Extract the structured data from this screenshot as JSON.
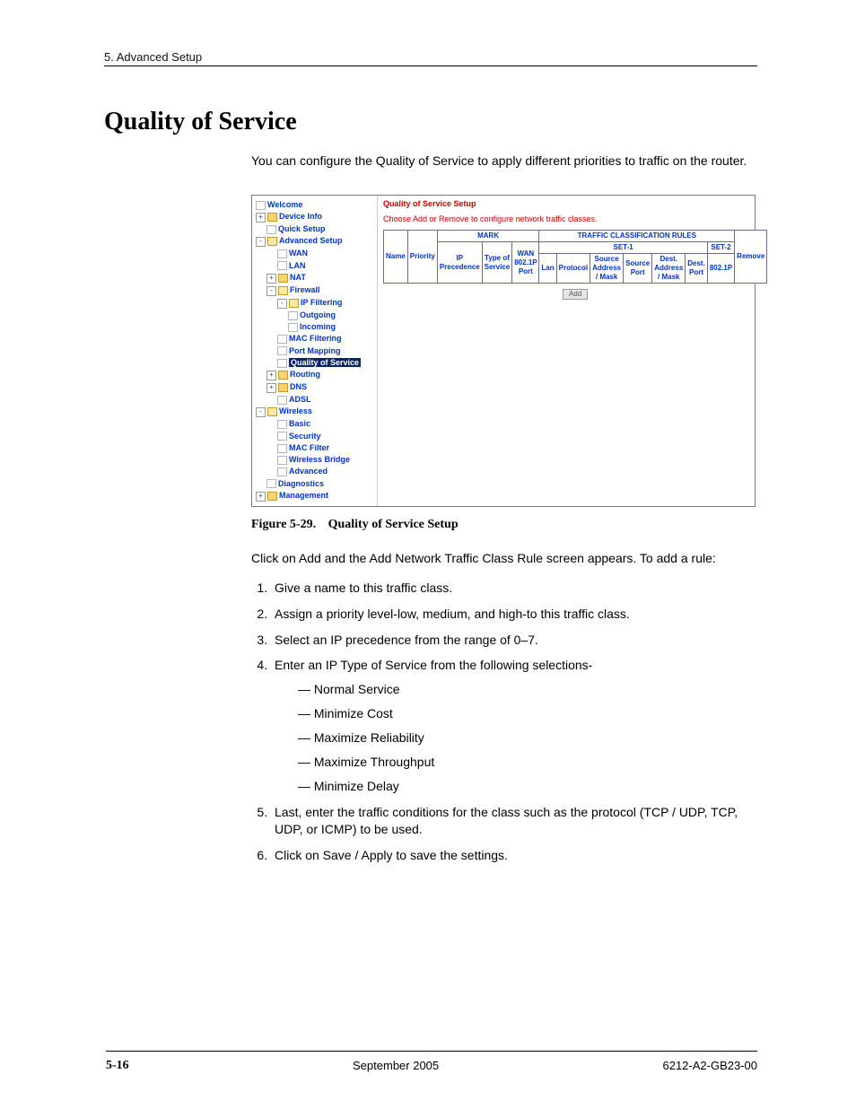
{
  "header": {
    "running": "5. Advanced Setup"
  },
  "title": "Quality of Service",
  "intro": "You can configure the Quality of Service to apply different priorities to traffic on the router.",
  "figure": {
    "number": "Figure 5-29.",
    "caption": "Quality of Service Setup"
  },
  "after_figure": "Click on Add and the Add Network Traffic Class Rule screen appears. To add a rule:",
  "steps": {
    "s1": "Give a name to this traffic class.",
    "s2": "Assign a priority level-low, medium, and high-to this traffic class.",
    "s3": "Select an IP precedence from the range of 0–7.",
    "s4": "Enter an IP Type of Service from the following selections-",
    "s4_items": {
      "a": "Normal Service",
      "b": "Minimize Cost",
      "c": "Maximize Reliability",
      "d": "Maximize Throughput",
      "e": "Minimize Delay"
    },
    "s5": "Last, enter the traffic conditions for the class such as the protocol (TCP / UDP, TCP, UDP, or ICMP) to be used.",
    "s6": "Click on Save / Apply to save the settings."
  },
  "footer": {
    "page": "5-16",
    "center": "September 2005",
    "right": "6212-A2-GB23-00"
  },
  "router": {
    "nav": {
      "welcome": "Welcome",
      "device_info": "Device Info",
      "quick_setup": "Quick Setup",
      "advanced_setup": "Advanced Setup",
      "wan": "WAN",
      "lan": "LAN",
      "nat": "NAT",
      "firewall": "Firewall",
      "ip_filtering": "IP Filtering",
      "outgoing": "Outgoing",
      "incoming": "Incoming",
      "mac_filtering": "MAC Filtering",
      "port_mapping": "Port Mapping",
      "qos": "Quality of Service",
      "routing": "Routing",
      "dns": "DNS",
      "adsl": "ADSL",
      "wireless": "Wireless",
      "basic": "Basic",
      "security": "Security",
      "mac_filter": "MAC Filter",
      "wireless_bridge": "Wireless Bridge",
      "advanced": "Advanced",
      "diagnostics": "Diagnostics",
      "management": "Management"
    },
    "content": {
      "title": "Quality of Service Setup",
      "subtitle": "Choose Add or Remove to configure network traffic classes.",
      "headers": {
        "mark": "MARK",
        "rules": "TRAFFIC CLASSIFICATION RULES",
        "set1": "SET-1",
        "set2": "SET-2",
        "name": "Name",
        "priority": "Priority",
        "ip_prec": "IP Precedence",
        "tos": "Type of Service",
        "wan8021p": "WAN 802.1P Port",
        "lan": "Lan",
        "protocol": "Protocol",
        "src_addr": "Source Address / Mask",
        "src_port": "Source Port",
        "dst_addr": "Dest. Address / Mask",
        "dst_port": "Dest. Port",
        "p8021": "802.1P",
        "remove": "Remove"
      },
      "add": "Add"
    }
  }
}
